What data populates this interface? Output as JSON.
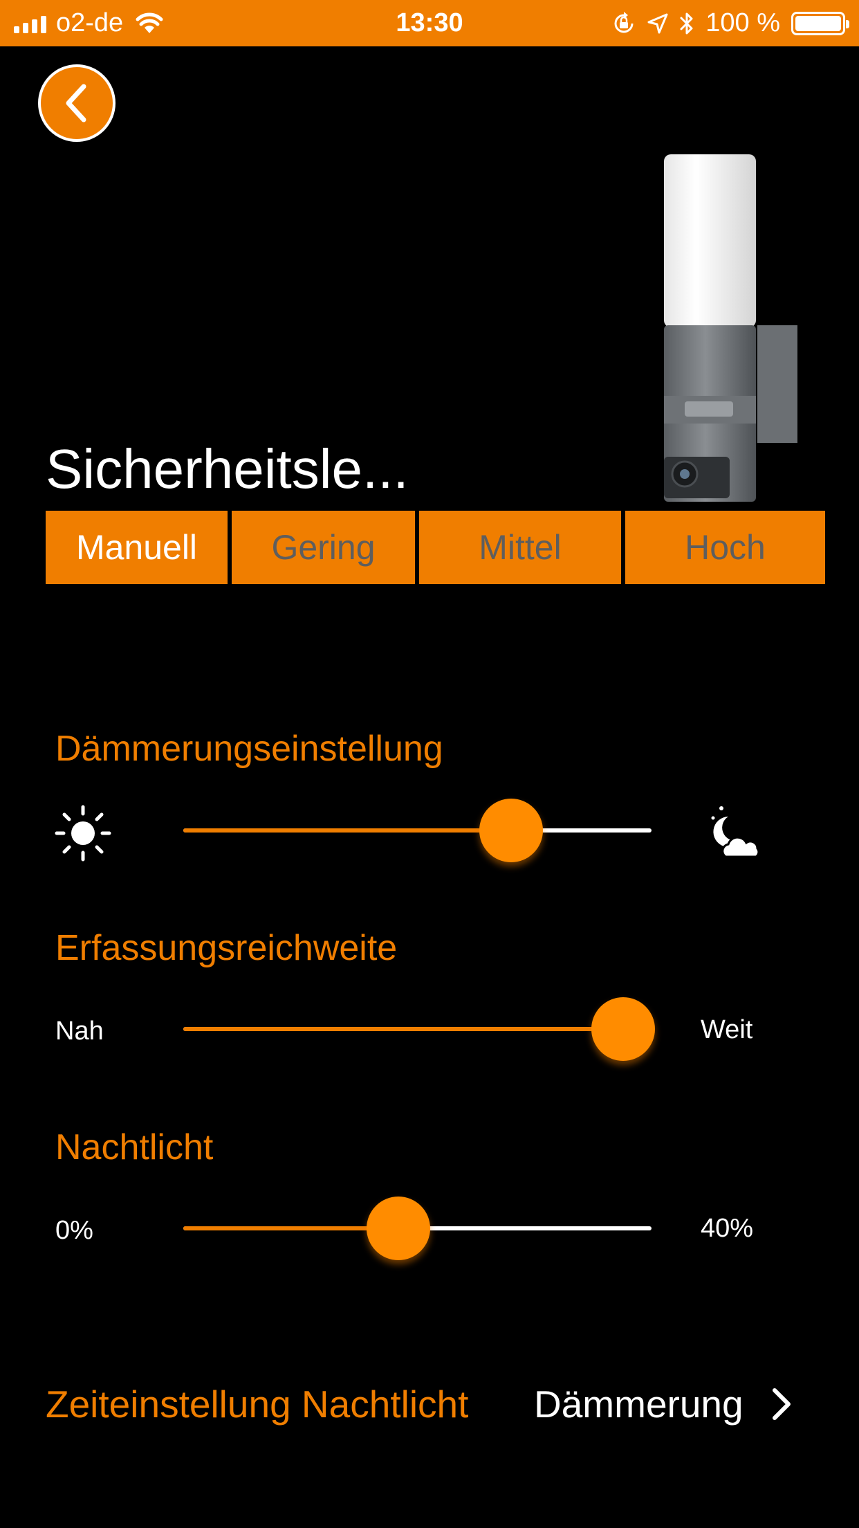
{
  "status_bar": {
    "carrier": "o2-de",
    "time": "13:30",
    "battery_percent": "100 %",
    "icons": [
      "signal-icon",
      "wifi-icon",
      "orientation-lock-icon",
      "location-icon",
      "bluetooth-icon",
      "battery-icon"
    ]
  },
  "header": {
    "back_icon": "chevron-left-icon",
    "profile_title": "Sicherheitsle...",
    "product_image": "lamp-camera-image"
  },
  "modes": {
    "selected": "Manuell",
    "items": [
      {
        "label": "Manuell"
      },
      {
        "label": "Gering"
      },
      {
        "label": "Mittel"
      },
      {
        "label": "Hoch"
      }
    ]
  },
  "settings": {
    "twilight": {
      "label": "Dämmerungseinstellung",
      "min_icon": "sun-icon",
      "max_icon": "moon-cloud-icon",
      "value": 0.7
    },
    "range": {
      "label": "Erfassungsreichweite",
      "min_label": "Nah",
      "max_label": "Weit",
      "value": 0.94
    },
    "night_light": {
      "label": "Nachtlicht",
      "min_label": "0%",
      "max_label": "40%",
      "value": 0.46
    }
  },
  "night_light_time": {
    "label": "Zeiteinstellung Nachtlicht",
    "value": "Dämmerung",
    "icon": "chevron-right-icon"
  },
  "colors": {
    "accent": "#f07e00",
    "background": "#000000",
    "inactive_text": "#5e5e5e"
  }
}
